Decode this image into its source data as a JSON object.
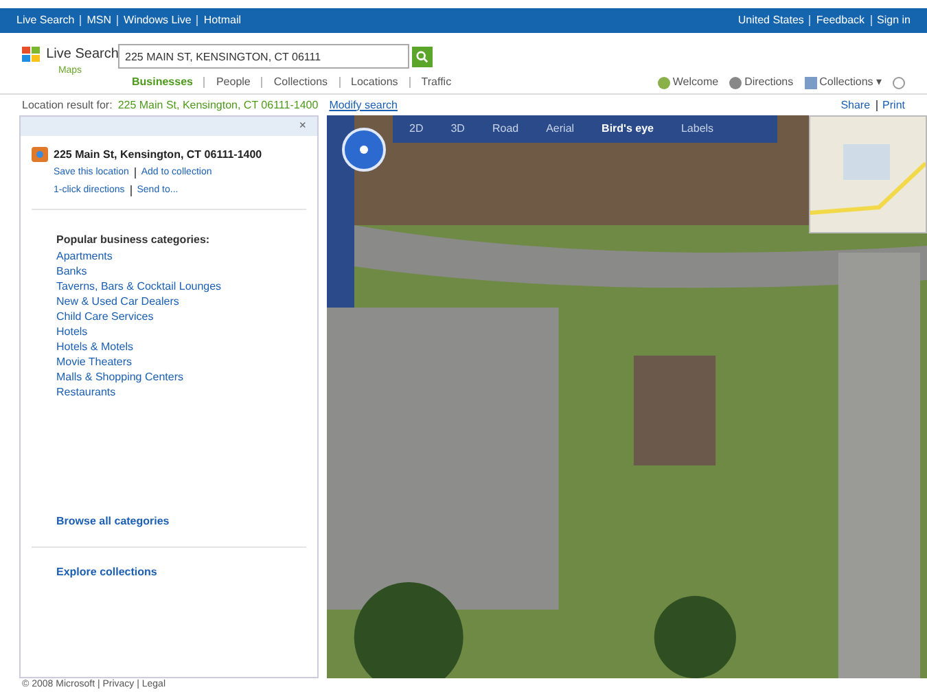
{
  "top_bar": {
    "left_links": [
      "Live Search",
      "MSN",
      "Windows Live",
      "Hotmail"
    ],
    "right_links": [
      "United States",
      "Feedback",
      "Sign in"
    ]
  },
  "header": {
    "logo": "Live Search",
    "logo_sub": "Maps",
    "search": {
      "value": "225 MAIN ST, KENSINGTON, CT 06111"
    },
    "tabs": [
      {
        "label": "Businesses",
        "selected": true
      },
      {
        "label": "People",
        "selected": false
      },
      {
        "label": "Collections",
        "selected": false
      },
      {
        "label": "Locations",
        "selected": false
      },
      {
        "label": "Traffic",
        "selected": false
      }
    ],
    "actions": [
      "Welcome",
      "Directions",
      "Collections ▾"
    ]
  },
  "location_line": {
    "prefix": "Location result for:",
    "address": "225 Main St, Kensington, CT 06111-1400",
    "link": "Modify search",
    "right_links": [
      "Share",
      "Print"
    ]
  },
  "panel": {
    "close": "×",
    "result": {
      "title": "225 Main St, Kensington, CT 06111-1400",
      "links_1": [
        "Save this location",
        "Add to collection"
      ],
      "links_2": [
        "1-click directions",
        "Send to..."
      ]
    },
    "categories_heading": "Popular business categories:",
    "categories": [
      "Apartments",
      "Banks",
      "Taverns, Bars & Cocktail Lounges",
      "New & Used Car Dealers",
      "Child Care Services",
      "Hotels",
      "Hotels & Motels",
      "Movie Theaters",
      "Malls & Shopping Centers",
      "Restaurants"
    ],
    "browse": "Browse all categories",
    "explore": "Explore collections"
  },
  "map": {
    "modes": [
      {
        "label": "2D",
        "selected": false
      },
      {
        "label": "3D",
        "selected": false
      },
      {
        "label": "Road",
        "selected": false
      },
      {
        "label": "Aerial",
        "selected": false
      },
      {
        "label": "Bird's eye",
        "selected": true
      },
      {
        "label": "Labels",
        "selected": false
      }
    ]
  },
  "footer": "© 2008 Microsoft | Privacy | Legal"
}
